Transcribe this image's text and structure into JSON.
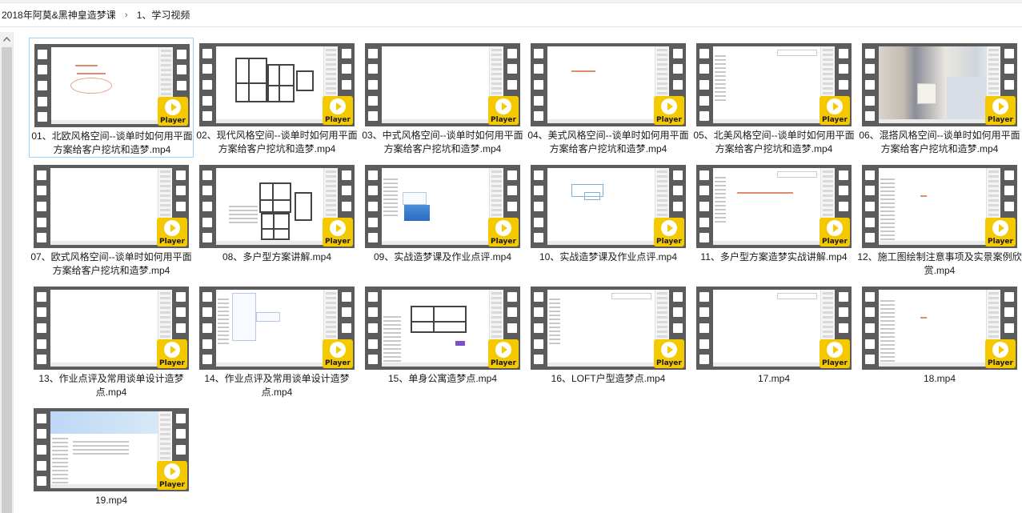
{
  "breadcrumb": {
    "items": [
      "2018年阿莫&黑神皇造梦课",
      "1、学习视频"
    ],
    "separator": "›"
  },
  "overlay_label": "Player",
  "colors": {
    "selection_border": "#99d1ff",
    "player_badge": "#f4c900",
    "film_strip": "#5c5c5c"
  },
  "files": [
    {
      "name": "01、北欧风格空间--谈单时如何用平面方案给客户挖坑和造梦.mp4",
      "thumb": "doodle"
    },
    {
      "name": "02、现代风格空间--谈单时如何用平面方案给客户挖坑和造梦.mp4",
      "thumb": "floorplan"
    },
    {
      "name": "03、中式风格空间--谈单时如何用平面方案给客户挖坑和造梦.mp4",
      "thumb": "blank"
    },
    {
      "name": "04、美式风格空间--谈单时如何用平面方案给客户挖坑和造梦.mp4",
      "thumb": "redtext"
    },
    {
      "name": "05、北美风格空间--谈单时如何用平面方案给客户挖坑和造梦.mp4",
      "thumb": "software"
    },
    {
      "name": "06、混搭风格空间--谈单时如何用平面方案给客户挖坑和造梦.mp4",
      "thumb": "photo"
    },
    {
      "name": "07、欧式风格空间--谈单时如何用平面方案给客户挖坑和造梦.mp4",
      "thumb": "blank"
    },
    {
      "name": "08、多户型方案讲解.mp4",
      "thumb": "floorplan2"
    },
    {
      "name": "09、实战造梦课及作业点评.mp4",
      "thumb": "chat"
    },
    {
      "name": "10、实战造梦课及作业点评.mp4",
      "thumb": "sketch"
    },
    {
      "name": "11、多户型方案造梦实战讲解.mp4",
      "thumb": "software-red"
    },
    {
      "name": "12、施工图绘制注意事项及实景案例欣赏.mp4",
      "thumb": "software-list"
    },
    {
      "name": "13、作业点评及常用谈单设计造梦点.mp4",
      "thumb": "blank-side"
    },
    {
      "name": "14、作业点评及常用谈单设计造梦点.mp4",
      "thumb": "menu"
    },
    {
      "name": "15、单身公寓造梦点.mp4",
      "thumb": "plan-purple"
    },
    {
      "name": "16、LOFT户型造梦点.mp4",
      "thumb": "software"
    },
    {
      "name": "17.mp4",
      "thumb": "software-blank"
    },
    {
      "name": "18.mp4",
      "thumb": "software-list"
    },
    {
      "name": "19.mp4",
      "thumb": "web"
    }
  ]
}
